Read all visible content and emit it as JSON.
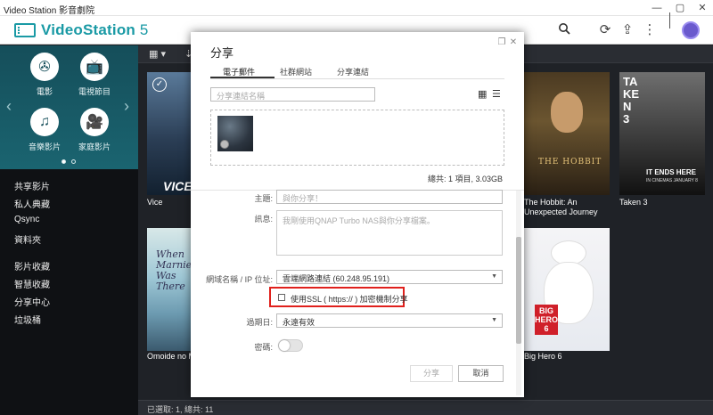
{
  "window": {
    "title": "Video Station 影音劇院"
  },
  "app": {
    "name_bold": "VideoStation",
    "name_suffix": " 5"
  },
  "sidebar": {
    "categories": [
      {
        "label": "電影",
        "icon": "film-reel-icon"
      },
      {
        "label": "電視節目",
        "icon": "tv-icon"
      },
      {
        "label": "音樂影片",
        "icon": "music-video-icon"
      },
      {
        "label": "家庭影片",
        "icon": "home-video-icon"
      }
    ],
    "nav_group1": [
      "共享影片",
      "私人典藏",
      "Qsync",
      "資料夾"
    ],
    "nav_group2": [
      "影片收藏",
      "智慧收藏",
      "分享中心",
      "垃圾桶"
    ]
  },
  "posters": [
    {
      "title": "Vice",
      "image_text": "VICE"
    },
    {
      "title": "The Hobbit: An Unexpected Journey",
      "image_text": "THE HOBBIT"
    },
    {
      "title": "Taken 3",
      "image_text": "TAKEN 3",
      "tagline": "IT ENDS HERE",
      "date": "IN CINEMAS JANUARY 8"
    },
    {
      "title": "Omoide no Ma…",
      "image_text": "When Marnie Was There"
    },
    {
      "title": "Big Hero 6",
      "image_text": "BIG HERO 6"
    }
  ],
  "status": {
    "text": "已選取: 1, 總共: 11"
  },
  "dialog": {
    "title": "分享",
    "tabs": [
      "電子郵件",
      "社群網站",
      "分享連結"
    ],
    "link_name_placeholder": "分享連結名稱",
    "total": "總共: 1 項目, 3.03GB",
    "subject_label": "主題:",
    "subject_placeholder": "與你分享！",
    "message_label": "訊息:",
    "message_placeholder": "我剛使用QNAP Turbo NAS與你分享檔案。",
    "domain_label": "網域名稱 / IP 位址:",
    "domain_value": "雲端網路連結 (60.248.95.191)",
    "ssl_label": "使用SSL ( https:// ) 加密機制分享",
    "expire_label": "過期日:",
    "expire_value": "永遠有效",
    "password_label": "密碼:",
    "share_button": "分享",
    "cancel_button": "取消"
  }
}
